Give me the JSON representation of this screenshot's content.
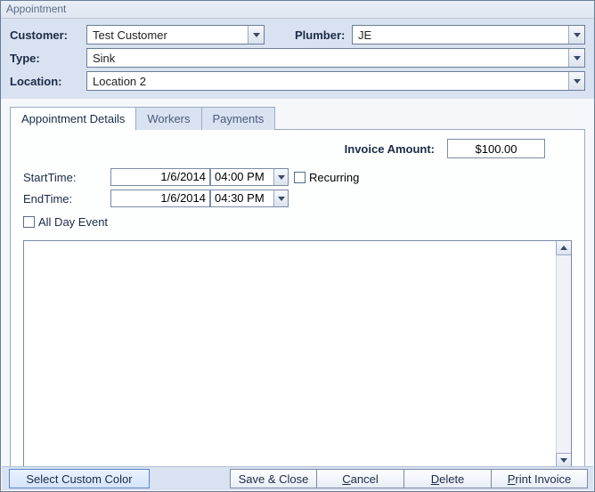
{
  "window": {
    "title": "Appointment"
  },
  "header": {
    "customer_label": "Customer:",
    "customer_value": "Test Customer",
    "plumber_label": "Plumber:",
    "plumber_value": "JE",
    "type_label": "Type:",
    "type_value": "Sink",
    "location_label": "Location:",
    "location_value": "Location 2"
  },
  "tabs": {
    "details": "Appointment Details",
    "workers": "Workers",
    "payments": "Payments",
    "active": "details"
  },
  "details": {
    "invoice_label": "Invoice Amount:",
    "invoice_value": "$100.00",
    "start_label": "StartTime:",
    "start_date": "1/6/2014",
    "start_time": "04:00 PM",
    "end_label": "EndTime:",
    "end_date": "1/6/2014",
    "end_time": "04:30 PM",
    "recurring_label": "Recurring",
    "recurring_checked": false,
    "allday_label": "All Day Event",
    "allday_checked": false,
    "notes": ""
  },
  "buttons": {
    "select_color": "Select Custom Color",
    "save_close": "Save & Close",
    "cancel_u": "C",
    "cancel_rest": "ancel",
    "delete_u": "D",
    "delete_rest": "elete",
    "print_u": "P",
    "print_rest": "rint Invoice"
  }
}
